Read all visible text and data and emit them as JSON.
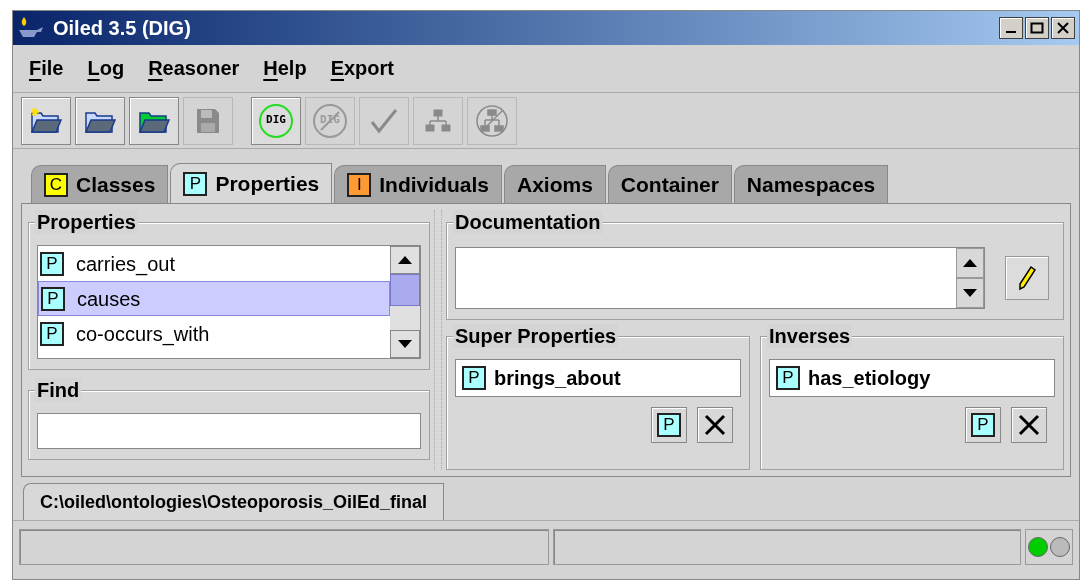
{
  "window": {
    "title": "Oiled 3.5 (DIG)"
  },
  "menu": [
    {
      "label": "File"
    },
    {
      "label": "Log"
    },
    {
      "label": "Reasoner"
    },
    {
      "label": "Help"
    },
    {
      "label": "Export"
    }
  ],
  "toolbar": [
    {
      "kind": "new",
      "disabled": false
    },
    {
      "kind": "open",
      "disabled": false
    },
    {
      "kind": "open-green",
      "disabled": false
    },
    {
      "kind": "save",
      "disabled": true
    },
    {
      "kind": "dig",
      "label": "DIG",
      "disabled": false
    },
    {
      "kind": "dig",
      "label": "DIG",
      "disabled": true
    },
    {
      "kind": "check",
      "disabled": true
    },
    {
      "kind": "tree",
      "disabled": true
    },
    {
      "kind": "tree-circle",
      "disabled": true
    }
  ],
  "tabs": [
    {
      "label": "Classes",
      "badge": "C",
      "color": "#ffff00",
      "selected": false
    },
    {
      "label": "Properties",
      "badge": "P",
      "color": "#aaffff",
      "selected": true
    },
    {
      "label": "Individuals",
      "badge": "I",
      "color": "#ff9933",
      "selected": false
    },
    {
      "label": "Axioms",
      "selected": false
    },
    {
      "label": "Container",
      "selected": false
    },
    {
      "label": "Namespaces",
      "selected": false
    }
  ],
  "properties": {
    "title": "Properties",
    "items": [
      {
        "badge": "P",
        "label": "carries_out",
        "selected": false
      },
      {
        "badge": "P",
        "label": "causes",
        "selected": true
      },
      {
        "badge": "P",
        "label": "co-occurs_with",
        "selected": false
      }
    ]
  },
  "find": {
    "title": "Find"
  },
  "documentation": {
    "title": "Documentation"
  },
  "super_properties": {
    "title": "Super Properties",
    "items": [
      {
        "badge": "P",
        "label": "brings_about"
      }
    ],
    "add_badge": "P"
  },
  "inverses": {
    "title": "Inverses",
    "items": [
      {
        "badge": "P",
        "label": "has_etiology"
      }
    ],
    "add_badge": "P"
  },
  "document_tab": {
    "label": "C:\\oiled\\ontologies\\Osteoporosis_OilEd_final"
  },
  "status_lights": [
    {
      "on": true
    },
    {
      "on": false
    }
  ]
}
